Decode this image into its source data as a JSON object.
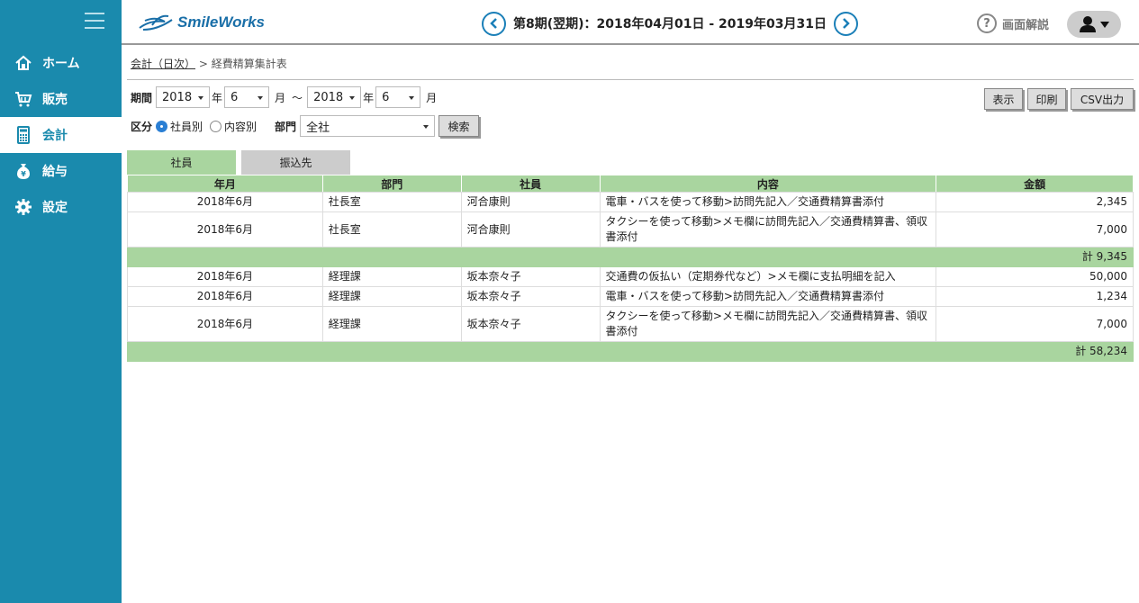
{
  "app": {
    "brand": "SmileWorks"
  },
  "header": {
    "period": "第8期(翌期)：2018年04月01日 - 2019年03月31日",
    "help_label": "画面解説"
  },
  "sidebar": {
    "items": [
      {
        "label": "ホーム",
        "icon": "home-icon",
        "active": false
      },
      {
        "label": "販売",
        "icon": "cart-icon",
        "active": false
      },
      {
        "label": "会計",
        "icon": "calculator-icon",
        "active": true
      },
      {
        "label": "給与",
        "icon": "yen-bag-icon",
        "active": false
      },
      {
        "label": "設定",
        "icon": "gear-icon",
        "active": false
      }
    ]
  },
  "breadcrumb": {
    "parent": "会計（日次）",
    "separator": " > ",
    "current": "経費精算集計表"
  },
  "filter": {
    "period_label": "期間",
    "from_year": "2018",
    "year_unit": "年",
    "from_month": "6",
    "month_unit": "月",
    "tilde": "〜",
    "to_year": "2018",
    "to_month": "6",
    "category_label": "区分",
    "radio_employee": "社員別",
    "radio_content": "内容別",
    "dept_label": "部門",
    "dept_value": "全社",
    "search_button": "検索"
  },
  "actions": {
    "display": "表示",
    "print": "印刷",
    "csv": "CSV出力"
  },
  "tabs": [
    {
      "label": "社員"
    },
    {
      "label": "振込先"
    }
  ],
  "table": {
    "headers": [
      "年月",
      "部門",
      "社員",
      "内容",
      "金額"
    ],
    "groups": [
      {
        "rows": [
          {
            "ym": "2018年6月",
            "dept": "社長室",
            "emp": "河合康則",
            "content": "電車・バスを使って移動>訪問先記入／交通費精算書添付",
            "amount": "2,345"
          },
          {
            "ym": "2018年6月",
            "dept": "社長室",
            "emp": "河合康則",
            "content": "タクシーを使って移動>メモ欄に訪問先記入／交通費精算書、領収書添付",
            "amount": "7,000"
          }
        ],
        "total": "計 9,345"
      },
      {
        "rows": [
          {
            "ym": "2018年6月",
            "dept": "経理課",
            "emp": "坂本奈々子",
            "content": "交通費の仮払い（定期券代など）>メモ欄に支払明細を記入",
            "amount": "50,000"
          },
          {
            "ym": "2018年6月",
            "dept": "経理課",
            "emp": "坂本奈々子",
            "content": "電車・バスを使って移動>訪問先記入／交通費精算書添付",
            "amount": "1,234"
          },
          {
            "ym": "2018年6月",
            "dept": "経理課",
            "emp": "坂本奈々子",
            "content": "タクシーを使って移動>メモ欄に訪問先記入／交通費精算書、領収書添付",
            "amount": "7,000"
          }
        ],
        "total": "計 58,234"
      }
    ]
  }
}
